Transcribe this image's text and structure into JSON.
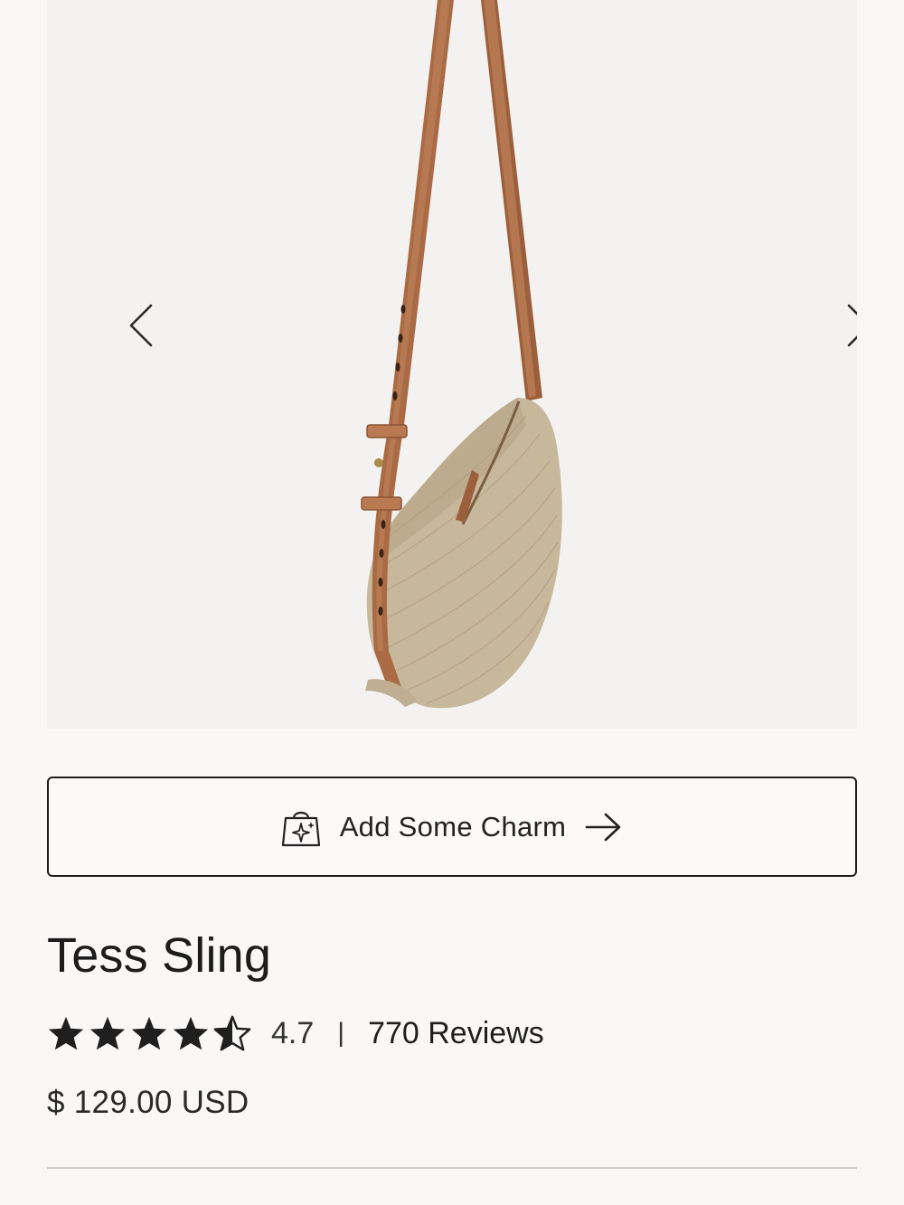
{
  "product": {
    "image_alt": "Tess Sling",
    "title": "Tess Sling",
    "rating": "4.7",
    "rating_stars": 4.5,
    "separator": "|",
    "reviews": "770 Reviews",
    "price": "$ 129.00 USD"
  },
  "gallery": {
    "prev_icon": "chevron-left-icon",
    "next_icon": "chevron-right-icon"
  },
  "charm_button": {
    "label": "Add Some Charm",
    "icon": "sparkle-bag-icon",
    "arrow_icon": "arrow-right-icon"
  },
  "colors": {
    "page_bg": "#f9f8f7",
    "image_bg": "#f3f2f1",
    "text": "#1f1f1f",
    "strap": "#a86a45",
    "straw": "#c6b69c"
  }
}
